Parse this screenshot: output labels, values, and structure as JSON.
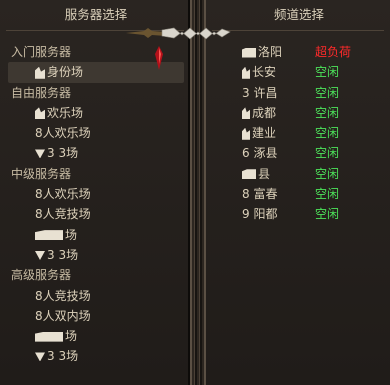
{
  "left_panel": {
    "title": "服务器选择",
    "rows": [
      {
        "kind": "category",
        "label": "入门服务器"
      },
      {
        "kind": "item",
        "label": "身份场",
        "icon": "figure-icon",
        "selected": true
      },
      {
        "kind": "category",
        "label": "自由服务器"
      },
      {
        "kind": "item",
        "label": "欢乐场",
        "icon": "figure-icon"
      },
      {
        "kind": "item",
        "label": "8人欢乐场"
      },
      {
        "kind": "item",
        "label": "3 3场",
        "icon": "triangle-icon"
      },
      {
        "kind": "category",
        "label": "中级服务器"
      },
      {
        "kind": "item",
        "label": "8人欢乐场"
      },
      {
        "kind": "item",
        "label": "8人竞技场"
      },
      {
        "kind": "item",
        "label": "场",
        "icon": "box-icon"
      },
      {
        "kind": "item",
        "label": "3 3场",
        "icon": "triangle-icon"
      },
      {
        "kind": "category",
        "label": "高级服务器"
      },
      {
        "kind": "item",
        "label": "8人竞技场"
      },
      {
        "kind": "item",
        "label": "8人双内场"
      },
      {
        "kind": "item",
        "label": "场",
        "icon": "box-icon"
      },
      {
        "kind": "item",
        "label": "3 3场",
        "icon": "triangle-icon"
      }
    ]
  },
  "right_panel": {
    "title": "频道选择",
    "channels": [
      {
        "name": "洛阳",
        "icon": "box-icon",
        "status": "超负荷",
        "status_kind": "full"
      },
      {
        "name": "长安",
        "icon": "figure-icon",
        "status": "空闲",
        "status_kind": "idle"
      },
      {
        "name": "3 许昌",
        "status": "空闲",
        "status_kind": "idle"
      },
      {
        "name": "成都",
        "icon": "figure-icon",
        "status": "空闲",
        "status_kind": "idle"
      },
      {
        "name": "建业",
        "icon": "figure-icon",
        "status": "空闲",
        "status_kind": "idle"
      },
      {
        "name": "6 涿县",
        "status": "空闲",
        "status_kind": "idle"
      },
      {
        "name": "县",
        "icon": "box-icon",
        "status": "空闲",
        "status_kind": "idle"
      },
      {
        "name": "8 富春",
        "status": "空闲",
        "status_kind": "idle"
      },
      {
        "name": "9 阳都",
        "status": "空闲",
        "status_kind": "idle"
      }
    ]
  },
  "colors": {
    "idle": "#4ce35a",
    "full": "#ff2a2a"
  }
}
